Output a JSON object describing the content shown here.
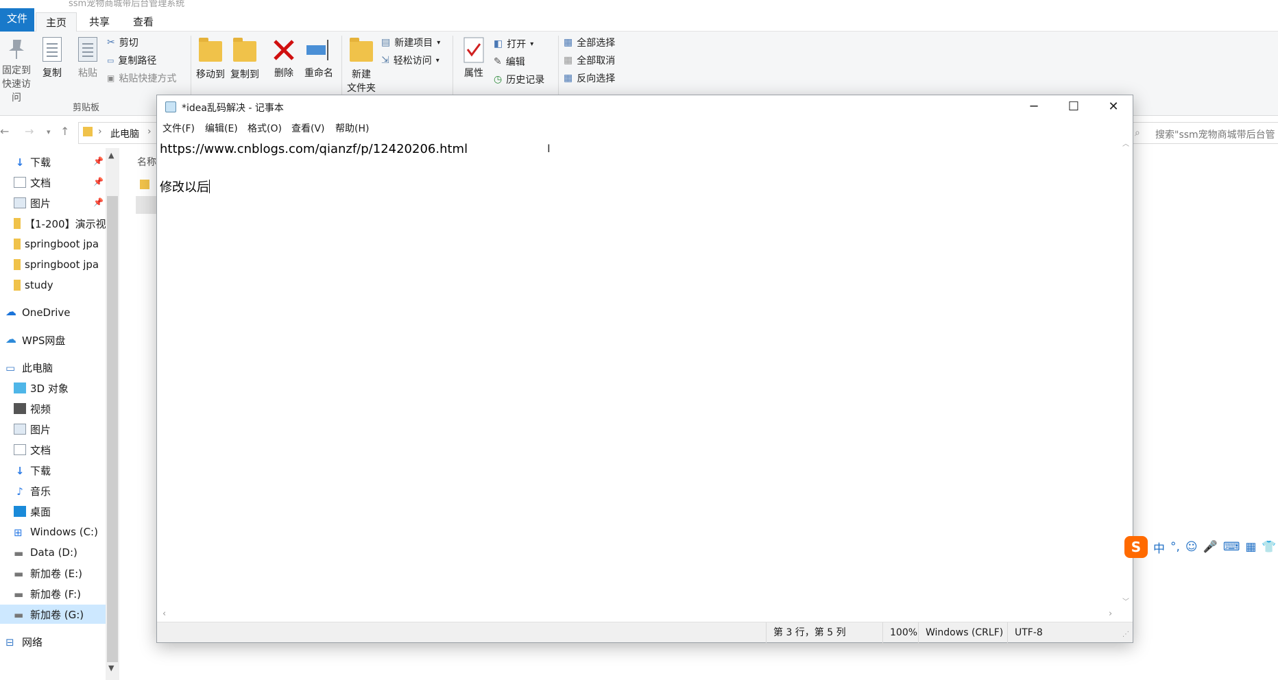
{
  "explorer": {
    "window_title": "ssm宠物商城带后台管理系统",
    "tabs": [
      {
        "label": "文件"
      },
      {
        "label": "主页"
      },
      {
        "label": "共享"
      },
      {
        "label": "查看"
      }
    ],
    "ribbon": {
      "pin_label": "固定到",
      "pin_label2": "快速访问",
      "copy": "复制",
      "paste": "粘贴",
      "cut": "剪切",
      "copy_path": "复制路径",
      "paste_shortcut": "粘贴快捷方式",
      "clipboard_group": "剪贴板",
      "move_to": "移动到",
      "copy_to": "复制到",
      "delete": "删除",
      "rename": "重命名",
      "new_item": "新建项目",
      "easy_access": "轻松访问",
      "new_folder": "新建",
      "new_folder2": "文件夹",
      "properties": "属性",
      "open": "打开",
      "edit": "编辑",
      "history": "历史记录",
      "select_all": "全部选择",
      "select_none": "全部取消",
      "invert_selection": "反向选择"
    },
    "address": {
      "crumb": "此电脑",
      "search_placeholder": "搜索\"ssm宠物商城带后台管"
    },
    "nav": {
      "items": [
        {
          "label": "下载"
        },
        {
          "label": "文档"
        },
        {
          "label": "图片"
        },
        {
          "label": "【1-200】演示视"
        },
        {
          "label": "springboot jpa"
        },
        {
          "label": "springboot jpa"
        },
        {
          "label": "study"
        },
        {
          "label": "OneDrive"
        },
        {
          "label": "WPS网盘"
        },
        {
          "label": "此电脑"
        },
        {
          "label": "3D 对象"
        },
        {
          "label": "视频"
        },
        {
          "label": "图片"
        },
        {
          "label": "文档"
        },
        {
          "label": "下载"
        },
        {
          "label": "音乐"
        },
        {
          "label": "桌面"
        },
        {
          "label": "Windows (C:)"
        },
        {
          "label": "Data (D:)"
        },
        {
          "label": "新加卷 (E:)"
        },
        {
          "label": "新加卷 (F:)"
        },
        {
          "label": "新加卷 (G:)"
        },
        {
          "label": "网络"
        }
      ]
    },
    "filelist": {
      "header_name": "名称"
    }
  },
  "notepad": {
    "title": "*idea乱码解决 - 记事本",
    "menu": [
      {
        "label": "文件(F)"
      },
      {
        "label": "编辑(E)"
      },
      {
        "label": "格式(O)"
      },
      {
        "label": "查看(V)"
      },
      {
        "label": "帮助(H)"
      }
    ],
    "lines": [
      "https://www.cnblogs.com/qianzf/p/12420206.html",
      "",
      "修改以后"
    ],
    "status": {
      "position": "第 3 行，第 5 列",
      "zoom": "100%",
      "line_ending": "Windows (CRLF)",
      "encoding": "UTF-8"
    }
  },
  "ime": {
    "logo": "S",
    "mode": "中",
    "punct": "°,"
  }
}
